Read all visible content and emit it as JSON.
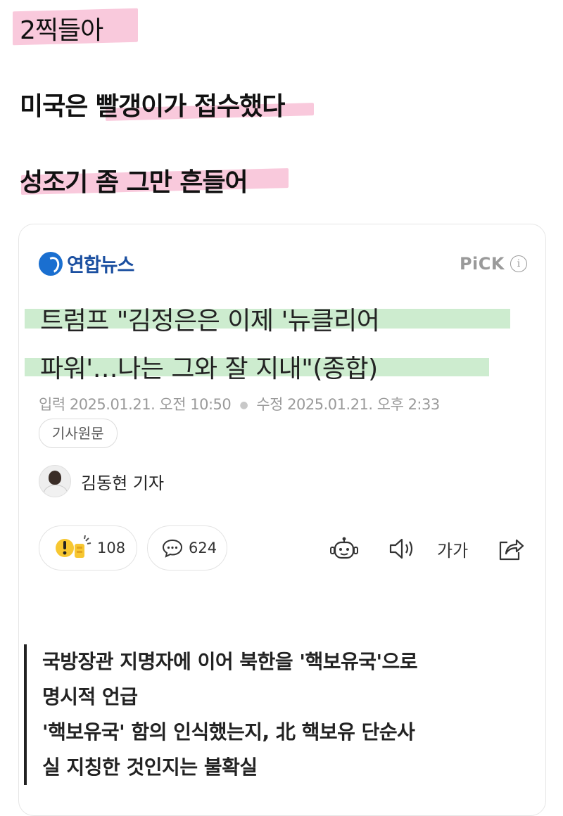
{
  "post": {
    "line1": "2찍들아",
    "line2": "미국은 빨갱이가 접수했다",
    "line3": "성조기 좀 그만 흔들어"
  },
  "article": {
    "publisher": "연합뉴스",
    "pick_label": "PiCK",
    "info_icon": "i",
    "headline_line1": "트럼프 \"김정은은 이제 '뉴클리어",
    "headline_line2": "파워'…나는 그와 잘 지내\"(종합)",
    "input_label": "입력",
    "input_time": "2025.01.21. 오전 10:50",
    "edit_label": "수정",
    "edit_time": "2025.01.21. 오후 2:33",
    "original_button": "기사원문",
    "author": "김동현 기자",
    "reaction_count": "108",
    "comment_count": "624",
    "font_size_label": "가가",
    "summary_line1": "국방장관 지명자에 이어 북한을 '핵보유국'으로",
    "summary_line2": "명시적 언급",
    "summary_line3": "'핵보유국' 함의 인식했는지, 北 핵보유 단순사",
    "summary_line4": "실 지칭한 것인지는 불확실"
  },
  "colors": {
    "highlight_pink": "#f9c9dc",
    "highlight_green": "#cdeccf",
    "publisher_blue": "#1b4fa0"
  }
}
